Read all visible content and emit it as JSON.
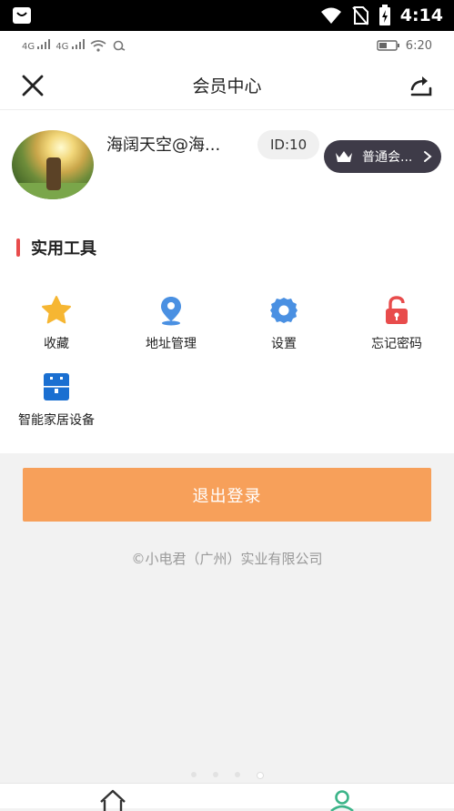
{
  "system_bar": {
    "time": "4:14",
    "icons": [
      "notification-bag-icon",
      "wifi-icon",
      "no-sim-icon",
      "battery-charging-icon"
    ]
  },
  "status_bar": {
    "left_icons": [
      "signal-4g-icon",
      "signal-4g-icon",
      "wifi-icon",
      "link-icon"
    ],
    "network_label_1": "4G",
    "network_label_2": "4G",
    "battery_time": "6:20"
  },
  "header": {
    "title": "会员中心",
    "close_icon": "close-icon",
    "share_icon": "share-icon"
  },
  "profile": {
    "nickname": "海阔天空@海...",
    "id_label": "ID:10",
    "member_label": "普通会...",
    "member_icon": "crown-icon",
    "member_arrow_icon": "chevron-right-icon"
  },
  "tools": {
    "section_title": "实用工具",
    "items": [
      {
        "label": "收藏",
        "icon": "star-icon",
        "color": "#f6b632"
      },
      {
        "label": "地址管理",
        "icon": "location-pin-icon",
        "color": "#4a90e2"
      },
      {
        "label": "设置",
        "icon": "gear-icon",
        "color": "#4a90e2"
      },
      {
        "label": "忘记密码",
        "icon": "unlock-icon",
        "color": "#e84c4c"
      },
      {
        "label": "智能家居设备",
        "icon": "smart-device-icon",
        "color": "#1a6fd1"
      }
    ]
  },
  "logout_label": "退出登录",
  "copyright": "©小电君（广州）实业有限公司",
  "colors": {
    "accent": "#f7a05a",
    "section_marker": "#e84c4c",
    "member_badge": "#3e3b48",
    "tab_active": "#3cb489"
  },
  "tabbar": {
    "items": [
      {
        "icon": "home-icon"
      },
      {
        "icon": "user-icon"
      }
    ]
  }
}
